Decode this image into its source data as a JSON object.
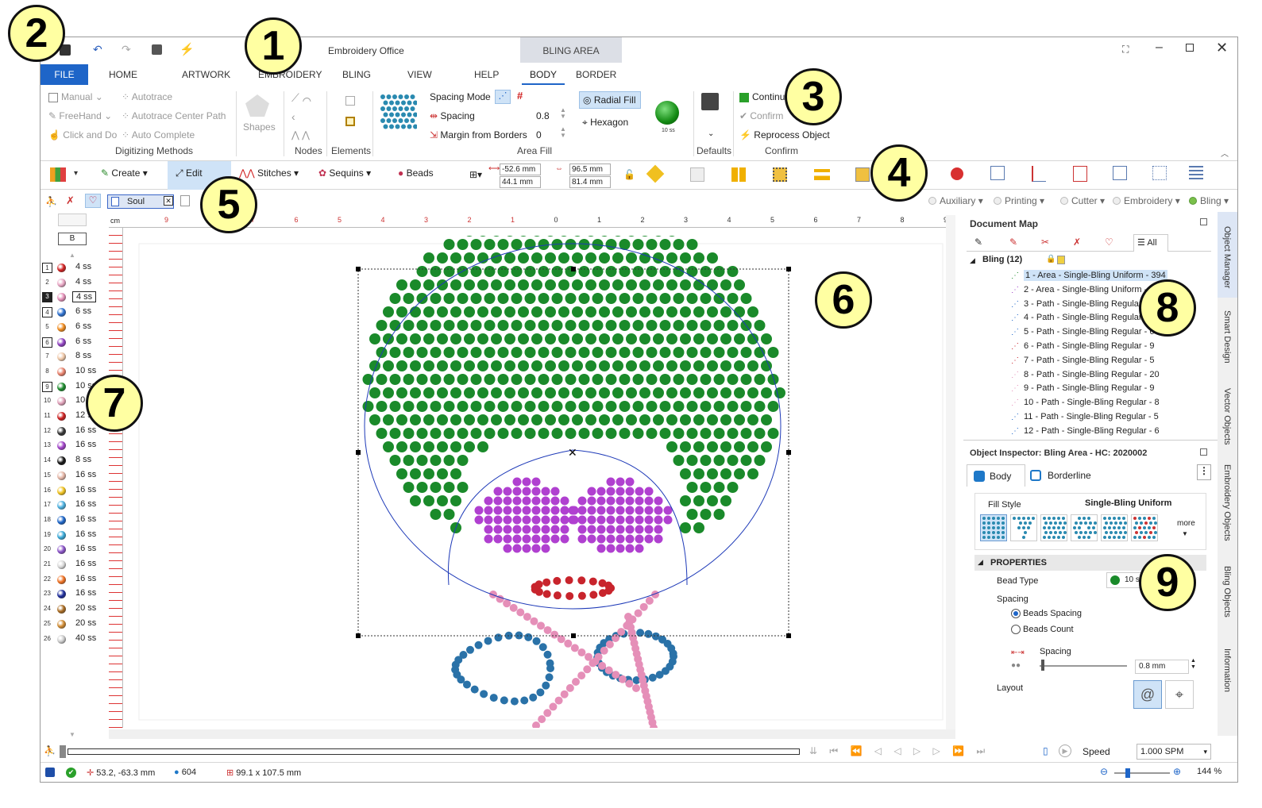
{
  "app": {
    "title": "Embroidery Office",
    "context_tab": "BLING AREA"
  },
  "tabs": [
    "FILE",
    "HOME",
    "ARTWORK",
    "EMBROIDERY",
    "BLING",
    "VIEW",
    "HELP",
    "BODY",
    "BORDER"
  ],
  "ribbon": {
    "digitizing": {
      "manual": "Manual",
      "freehand": "FreeHand",
      "click_do": "Click and Do",
      "autotrace": "Autotrace",
      "autotrace_center": "Autotrace Center Path",
      "auto_complete": "Auto Complete",
      "group": "Digitizing Methods"
    },
    "shapes": "Shapes",
    "nodes": "Nodes",
    "elements": "Elements",
    "area_fill": {
      "spacing_mode": "Spacing Mode",
      "spacing": "Spacing",
      "spacing_val": "0.8",
      "margin": "Margin from Borders",
      "margin_val": "0",
      "radial": "Radial Fill",
      "hexagon": "Hexagon",
      "group": "Area Fill",
      "bead": "10 ss"
    },
    "defaults": "Defaults",
    "confirm": {
      "continue": "Continu",
      "confirm": "Confirm",
      "reprocess": "Reprocess Object",
      "group": "Confirm"
    }
  },
  "toolbar": {
    "create": "Create",
    "edit": "Edit",
    "stitches": "Stitches",
    "sequins": "Sequins",
    "beads": "Beads",
    "x": "-52.6 mm",
    "y": "44.1 mm",
    "w": "96.5 mm",
    "h": "81.4 mm"
  },
  "design_tab": "Soul",
  "layers": [
    "Auxiliary",
    "Printing",
    "Cutter",
    "Embroidery",
    "Bling"
  ],
  "palette_header": "B",
  "threads": [
    {
      "n": "1",
      "c": "#d21f1f",
      "s": "4 ss",
      "box": true
    },
    {
      "n": "2",
      "c": "#e9a6c4",
      "s": "4 ss"
    },
    {
      "n": "3",
      "c": "#e58fb8",
      "s": "4 ss",
      "sel": true
    },
    {
      "n": "4",
      "c": "#2a6fd0",
      "s": "6 ss",
      "box": true
    },
    {
      "n": "5",
      "c": "#f08a1c",
      "s": "6 ss"
    },
    {
      "n": "6",
      "c": "#8e3fc0",
      "s": "6 ss",
      "box": true
    },
    {
      "n": "7",
      "c": "#f0c8a8",
      "s": "8 ss"
    },
    {
      "n": "8",
      "c": "#e8806a",
      "s": "10 ss"
    },
    {
      "n": "9",
      "c": "#1a8a2a",
      "s": "10 ss",
      "box": true
    },
    {
      "n": "10",
      "c": "#e0a0b8",
      "s": "10 ss"
    },
    {
      "n": "11",
      "c": "#cc1c1c",
      "s": "12 ss"
    },
    {
      "n": "12",
      "c": "#333333",
      "s": "16 ss"
    },
    {
      "n": "13",
      "c": "#a040c8",
      "s": "16 ss"
    },
    {
      "n": "14",
      "c": "#111111",
      "s": "8 ss"
    },
    {
      "n": "15",
      "c": "#e6b6a6",
      "s": "16 ss"
    },
    {
      "n": "16",
      "c": "#f0c21c",
      "s": "16 ss"
    },
    {
      "n": "17",
      "c": "#4ab0e0",
      "s": "16 ss"
    },
    {
      "n": "18",
      "c": "#1a64c8",
      "s": "16 ss"
    },
    {
      "n": "19",
      "c": "#36a8d8",
      "s": "16 ss"
    },
    {
      "n": "20",
      "c": "#8a52c8",
      "s": "16 ss"
    },
    {
      "n": "21",
      "c": "#d8d8d8",
      "s": "16 ss"
    },
    {
      "n": "22",
      "c": "#f07020",
      "s": "16 ss"
    },
    {
      "n": "23",
      "c": "#1a2a9a",
      "s": "16 ss"
    },
    {
      "n": "24",
      "c": "#a86a20",
      "s": "20 ss"
    },
    {
      "n": "25",
      "c": "#d08a30",
      "s": "20 ss"
    },
    {
      "n": "26",
      "c": "#cccccc",
      "s": "40 ss"
    }
  ],
  "ruler_unit": "cm",
  "ruler_top": [
    "9",
    "8",
    "7",
    "6",
    "5",
    "4",
    "3",
    "2",
    "1",
    "0",
    "1",
    "2",
    "3",
    "4",
    "5",
    "6",
    "7",
    "8",
    "9"
  ],
  "docmap": {
    "title": "Document Map",
    "all": "All",
    "root": "Bling (12)",
    "items": [
      {
        "t": "1 - Area - Single-Bling Uniform - 394",
        "c": "#1a8a2a",
        "sel": true
      },
      {
        "t": "2 - Area - Single-Bling Uniform - 115",
        "c": "#a040c8"
      },
      {
        "t": "3 - Path - Single-Bling Regular - 10",
        "c": "#1a64c8"
      },
      {
        "t": "4 - Path - Single-Bling Regular - 17",
        "c": "#1a64c8"
      },
      {
        "t": "5 - Path - Single-Bling Regular - 6",
        "c": "#1a64c8"
      },
      {
        "t": "6 - Path - Single-Bling Regular - 9",
        "c": "#c8242c"
      },
      {
        "t": "7 - Path - Single-Bling Regular - 5",
        "c": "#c8242c"
      },
      {
        "t": "8 - Path - Single-Bling Regular - 20",
        "c": "#e58fb8"
      },
      {
        "t": "9 - Path - Single-Bling Regular - 9",
        "c": "#e58fb8"
      },
      {
        "t": "10 - Path - Single-Bling Regular - 8",
        "c": "#e58fb8"
      },
      {
        "t": "11 - Path - Single-Bling Regular - 5",
        "c": "#1a64c8"
      },
      {
        "t": "12 - Path - Single-Bling Regular - 6",
        "c": "#1a64c8"
      }
    ]
  },
  "inspector": {
    "title": "Object Inspector: Bling Area - HC: 2020002",
    "body": "Body",
    "borderline": "Borderline",
    "fill_style": "Fill Style",
    "fill_value": "Single-Bling Uniform",
    "more": "more",
    "properties": "PROPERTIES",
    "bead_type": "Bead Type",
    "bead_val": "10 ss",
    "spacing": "Spacing",
    "beads_spacing": "Beads Spacing",
    "beads_count": "Beads Count",
    "spacing2": "Spacing",
    "spacing_val": "0.8 mm",
    "layout": "Layout"
  },
  "sidetabs": [
    "Object Manager",
    "Smart Design",
    "Vector Objects",
    "Embroidery Objects",
    "Bling Objects",
    "Information"
  ],
  "timeline": {
    "speed": "Speed",
    "speed_val": "1.000 SPM"
  },
  "status": {
    "pos": "53.2, -63.3 mm",
    "count": "604",
    "size": "99.1 x 107.5 mm",
    "zoom": "144 %"
  },
  "callouts": [
    "1",
    "2",
    "3",
    "4",
    "5",
    "6",
    "7",
    "8",
    "9"
  ],
  "colors": {
    "accent": "#1e65c8",
    "green": "#1a8a2a",
    "purple": "#b040d0",
    "red": "#c8242c",
    "pink": "#e58fb8",
    "blue": "#2a72a8",
    "callout": "#ffffa2"
  }
}
